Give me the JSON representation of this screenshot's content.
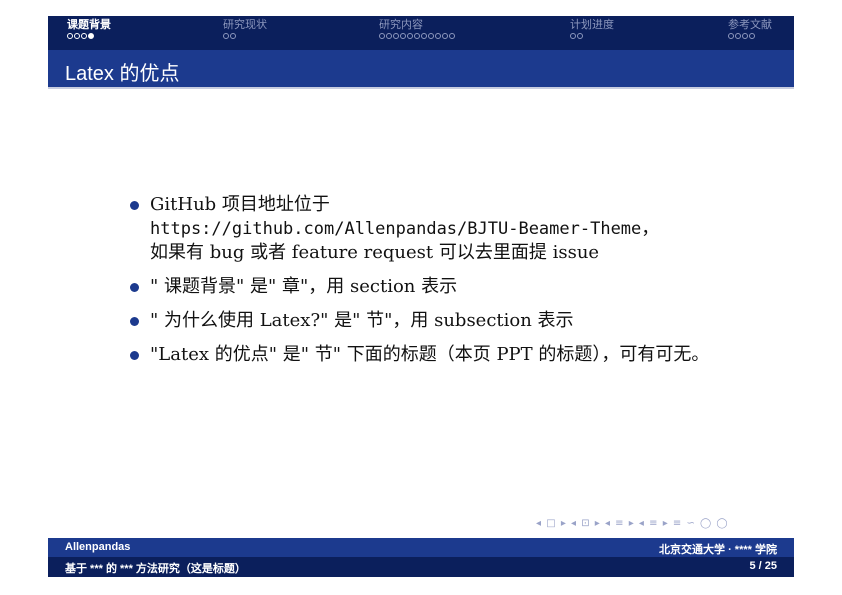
{
  "headline": {
    "sections": [
      {
        "label": "课题背景",
        "dots": 4,
        "filled_index": 3,
        "active": true
      },
      {
        "label": "研究现状",
        "dots": 2,
        "filled_index": -1,
        "active": false
      },
      {
        "label": "研究内容",
        "dots": 11,
        "filled_index": -1,
        "active": false
      },
      {
        "label": "计划进度",
        "dots": 2,
        "filled_index": -1,
        "active": false
      },
      {
        "label": "参考文献",
        "dots": 4,
        "filled_index": -1,
        "active": false
      }
    ]
  },
  "frame": {
    "title": "Latex 的优点"
  },
  "bullets": [
    {
      "pre": "GitHub 项目地址位于",
      "url": "https://github.com/Allenpandas/BJTU-Beamer-Theme",
      "url_suffix": "，",
      "post": "如果有 bug 或者 feature request 可以去里面提 issue"
    },
    {
      "text": "\" 课题背景\" 是\" 章\"，用 section 表示"
    },
    {
      "text": "\" 为什么使用 Latex?\" 是\" 节\"，用 subsection 表示"
    },
    {
      "text": "\"Latex 的优点\" 是\" 节\" 下面的标题（本页 PPT 的标题），可有可无。"
    }
  ],
  "nav_symbols": "◂ □ ▸  ◂ ⊡ ▸  ◂ ≡ ▸  ◂ ≡ ▸   ≡   ∽ ◯ ◯",
  "footer": {
    "author": "Allenpandas",
    "institute": "北京交通大学 · **** 学院",
    "title": "基于 *** 的 *** 方法研究（这是标题）",
    "page": "5 / 25"
  },
  "colors": {
    "headline_bg": "#0b1f5c",
    "frametitle_bg": "#1c3a8e",
    "bullet": "#1c3a8e"
  }
}
